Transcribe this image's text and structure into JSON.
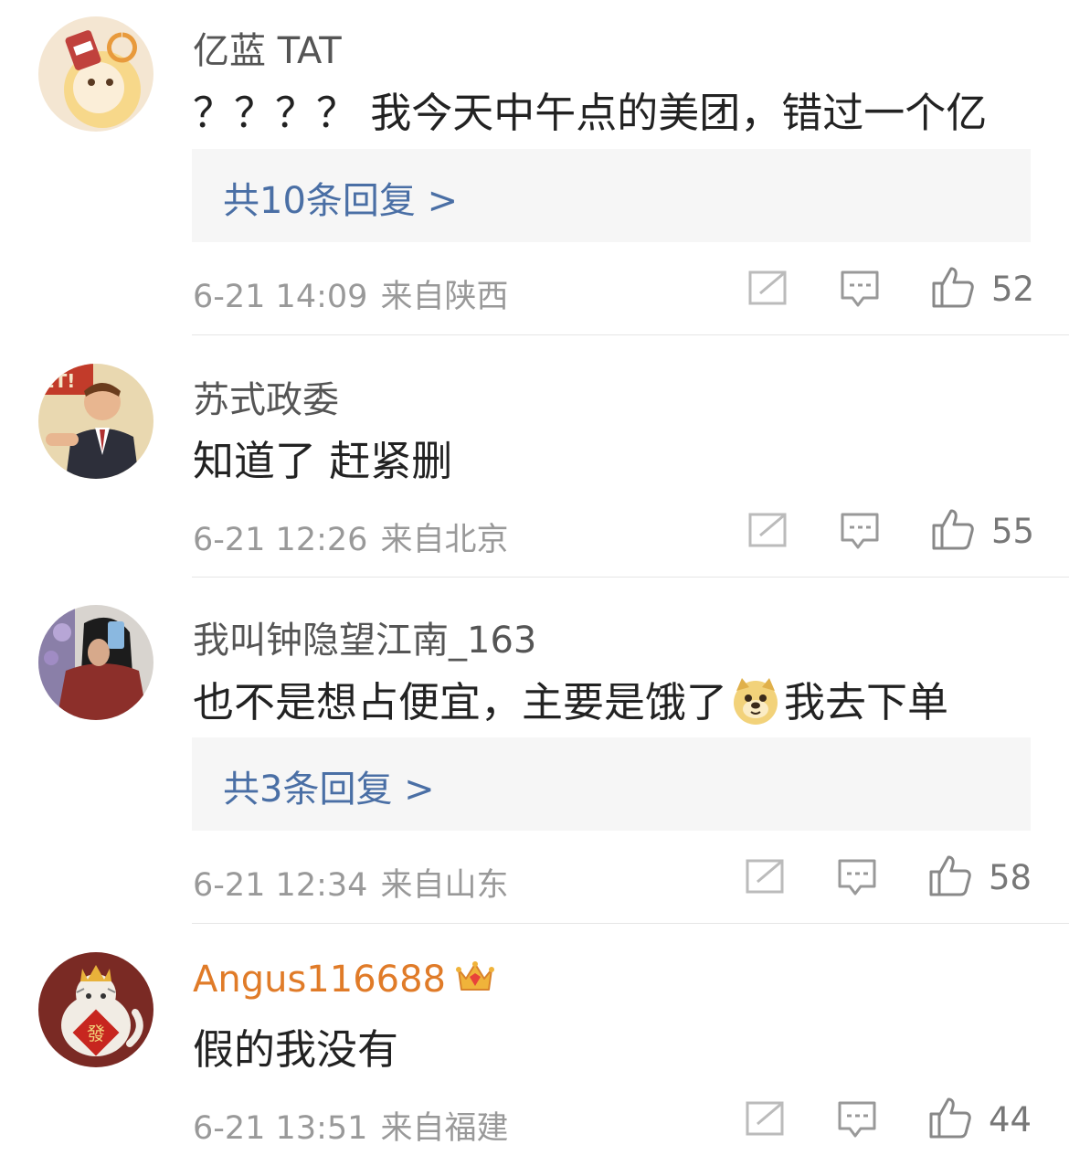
{
  "comments": [
    {
      "username": "亿蓝 TAT",
      "text": "？？？？ 我今天中午点的美团，错过一个亿",
      "replies_label": "共10条回复 >",
      "time": "6-21 14:09",
      "location": "来自陕西",
      "likes": "52"
    },
    {
      "username": "苏式政委",
      "text": "知道了 赶紧删",
      "time": "6-21 12:26",
      "location": "来自北京",
      "likes": "55",
      "avatar_text": "ЕТ!"
    },
    {
      "username": "我叫钟隐望江南_163",
      "text_before": "也不是想占便宜，主要是饿了",
      "text_after": "我去下单",
      "emoji": "doge-emoji",
      "replies_label": "共3条回复 >",
      "time": "6-21 12:34",
      "location": "来自山东",
      "likes": "58"
    },
    {
      "username": "Angus116688",
      "badge": "crown-vip-icon",
      "text": "假的我没有",
      "time": "6-21 13:51",
      "location": "来自福建",
      "likes": "44",
      "avatar_text": "發"
    }
  ],
  "colors": {
    "username": "#555555",
    "vip_username": "#e07b28",
    "reply_link": "#4a6fa5",
    "reply_bg": "#f6f6f6",
    "meta": "#999999"
  },
  "icons": [
    "share-icon",
    "comment-icon",
    "like-icon"
  ]
}
